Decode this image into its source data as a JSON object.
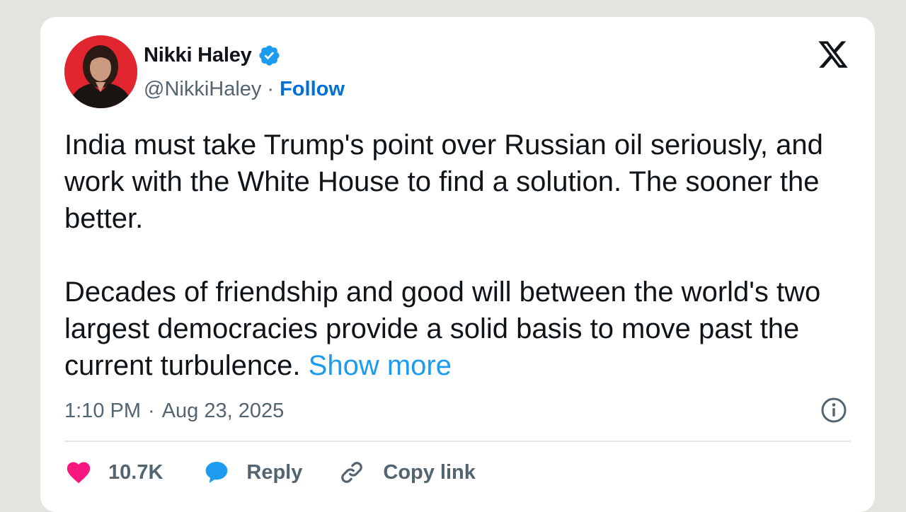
{
  "author": {
    "name": "Nikki Haley",
    "handle": "@NikkiHaley",
    "separator": "·",
    "follow_label": "Follow"
  },
  "tweet": {
    "paragraphs": [
      "India must take Trump's point over Russian oil seriously, and work with the White House to find a solution. The sooner the better.",
      "Decades of friendship and good will between the world's two largest democracies provide a solid basis to move past the current turbulence."
    ],
    "show_more_label": "Show more"
  },
  "meta": {
    "time": "1:10 PM",
    "separator": "·",
    "date": "Aug 23, 2025"
  },
  "actions": {
    "like_count": "10.7K",
    "reply_label": "Reply",
    "copy_link_label": "Copy link"
  },
  "icons": {
    "verified": "verified-badge-icon",
    "logo": "x-logo-icon",
    "info": "info-icon",
    "like": "heart-icon",
    "reply": "speech-bubble-icon",
    "copy": "link-icon"
  },
  "colors": {
    "background": "#e4e4df",
    "card": "#ffffff",
    "text": "#0f1419",
    "muted": "#536471",
    "follow": "#006fd6",
    "link": "#1d9bf0",
    "heart": "#f91880",
    "verified": "#1d9bf0"
  }
}
